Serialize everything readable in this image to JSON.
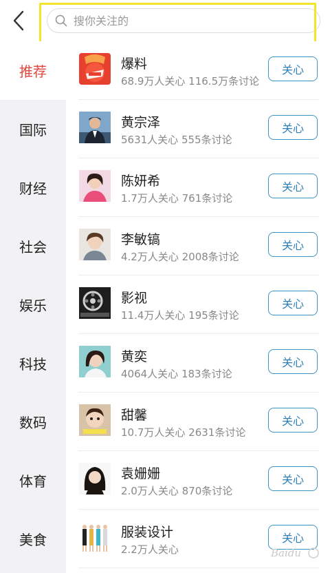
{
  "search": {
    "placeholder": "搜你关注的"
  },
  "sidebar": {
    "items": [
      {
        "label": "推荐",
        "active": true
      },
      {
        "label": "国际"
      },
      {
        "label": "财经"
      },
      {
        "label": "社会"
      },
      {
        "label": "娱乐"
      },
      {
        "label": "科技"
      },
      {
        "label": "数码"
      },
      {
        "label": "体育"
      },
      {
        "label": "美食"
      }
    ]
  },
  "list": {
    "items": [
      {
        "name": "爆料",
        "meta": "68.9万人关心 116.5万条讨论",
        "follow": "关心"
      },
      {
        "name": "黄宗泽",
        "meta": "5631人关心 555条讨论",
        "follow": "关心"
      },
      {
        "name": "陈妍希",
        "meta": "1.7万人关心 761条讨论",
        "follow": "关心"
      },
      {
        "name": "李敏镐",
        "meta": "4.2万人关心 2008条讨论",
        "follow": "关心"
      },
      {
        "name": "影视",
        "meta": "11.4万人关心 195条讨论",
        "follow": "关心"
      },
      {
        "name": "黄奕",
        "meta": "4064人关心 183条讨论",
        "follow": "关心"
      },
      {
        "name": "甜馨",
        "meta": "10.7万人关心 2631条讨论",
        "follow": "关心"
      },
      {
        "name": "袁姗姗",
        "meta": "2.0万人关心 870条讨论",
        "follow": "关心"
      },
      {
        "name": "服装设计",
        "meta": "2.2万人关心",
        "follow": "关心"
      }
    ]
  },
  "colors": {
    "accent_red": "#e3453d",
    "button_blue": "#3b93c7",
    "highlight_yellow": "#f2e32b"
  }
}
